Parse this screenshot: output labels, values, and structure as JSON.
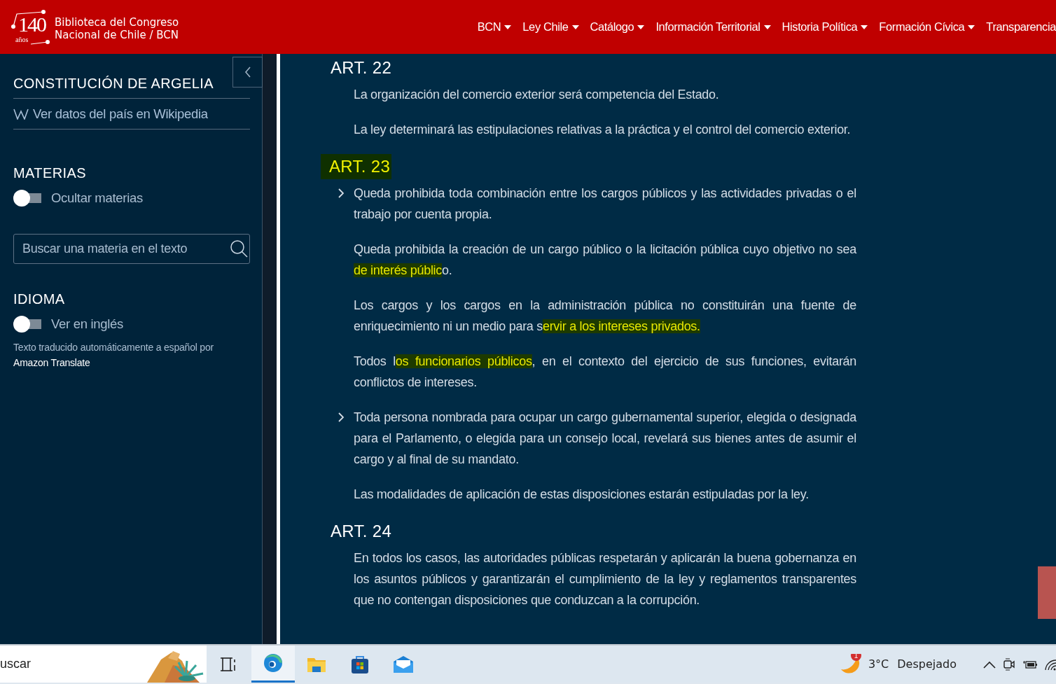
{
  "header": {
    "logo": {
      "number": "140",
      "caption": "años",
      "name_line_1": "Biblioteca del Congreso",
      "name_line_2": "Nacional de Chile / BCN"
    },
    "nav": [
      {
        "label": "BCN",
        "dropdown": true
      },
      {
        "label": "Ley Chile",
        "dropdown": true
      },
      {
        "label": "Catálogo",
        "dropdown": true
      },
      {
        "label": "Información Territorial",
        "dropdown": true
      },
      {
        "label": "Historia Política",
        "dropdown": true
      },
      {
        "label": "Formación Cívica",
        "dropdown": true
      },
      {
        "label": "Transparencia",
        "dropdown": false
      }
    ]
  },
  "sidebar": {
    "title": "CONSTITUCIÓN DE ARGELIA",
    "wiki_link": "Ver datos del país en Wikipedia",
    "materias": {
      "heading": "MATERIAS",
      "toggle": {
        "label": "Ocultar materias",
        "on": false
      }
    },
    "search": {
      "placeholder": "Buscar una materia en el texto"
    },
    "idioma": {
      "heading": "IDIOMA",
      "toggle": {
        "label": "Ver en inglés",
        "on": false
      },
      "note": "Texto traducido automáticamente a español por",
      "note_link": "Amazon Translate"
    }
  },
  "articles": [
    {
      "title": "ART. 22",
      "highlighted": false,
      "paragraphs": [
        {
          "bullet": false,
          "segments": [
            {
              "text": "La organización del comercio exterior será competencia del Estado.",
              "highlighted": false
            }
          ]
        },
        {
          "bullet": false,
          "segments": [
            {
              "text": "La ley determinará las estipulaciones relativas a la práctica y el control del comercio exterior.",
              "highlighted": false
            }
          ]
        }
      ]
    },
    {
      "title": "ART. 23",
      "highlighted": true,
      "paragraphs": [
        {
          "bullet": true,
          "segments": [
            {
              "text": "Queda prohibida toda combinación entre los cargos públicos y las actividades privadas o el trabajo por cuenta propia.",
              "highlighted": false
            }
          ]
        },
        {
          "bullet": false,
          "segments": [
            {
              "text": "Queda prohibida la creación de un cargo público o la licitación pública cuyo objetivo no sea ",
              "highlighted": false
            },
            {
              "text": "de interés públic",
              "highlighted": true
            },
            {
              "text": "o.",
              "highlighted": false
            }
          ]
        },
        {
          "bullet": false,
          "segments": [
            {
              "text": "Los cargos y los cargos en la administración pública no constituirán una fuente de enriquecimiento ni un medio para s",
              "highlighted": false
            },
            {
              "text": "ervir a los intereses privados.",
              "highlighted": true
            }
          ]
        },
        {
          "bullet": false,
          "segments": [
            {
              "text": "Todos l",
              "highlighted": false
            },
            {
              "text": "os funcionarios públicos",
              "highlighted": true
            },
            {
              "text": ", en el contexto del ejercicio de sus funciones, evitarán conflictos de intereses.",
              "highlighted": false
            }
          ]
        },
        {
          "bullet": true,
          "segments": [
            {
              "text": "Toda persona nombrada para ocupar un cargo gubernamental superior, elegida o designada para el Parlamento, o elegida para un consejo local, revelará sus bienes antes de asumir el cargo y al final de su mandato.",
              "highlighted": false
            }
          ]
        },
        {
          "bullet": false,
          "segments": [
            {
              "text": "Las modalidades de aplicación de estas disposiciones estarán estipuladas por la ley.",
              "highlighted": false
            }
          ]
        }
      ]
    },
    {
      "title": "ART. 24",
      "highlighted": false,
      "paragraphs": [
        {
          "bullet": false,
          "segments": [
            {
              "text": "En todos los casos, las autoridades públicas respetarán y aplicarán la buena gobernanza en los asuntos públicos y garantizarán el cumplimiento de la ley y reglamentos transparentes que no contengan disposiciones que conduzcan a la corrupción.",
              "highlighted": false
            }
          ]
        }
      ]
    }
  ],
  "taskbar": {
    "search_text": "uscar",
    "apps": [
      {
        "kind": "task-view",
        "selected": false
      },
      {
        "kind": "browser",
        "selected": true
      },
      {
        "kind": "folder",
        "selected": false
      },
      {
        "kind": "store",
        "selected": false
      },
      {
        "kind": "mail",
        "selected": false
      }
    ],
    "weather": {
      "badge": "1",
      "temperature": "3°C",
      "condition": "Despejado"
    }
  }
}
